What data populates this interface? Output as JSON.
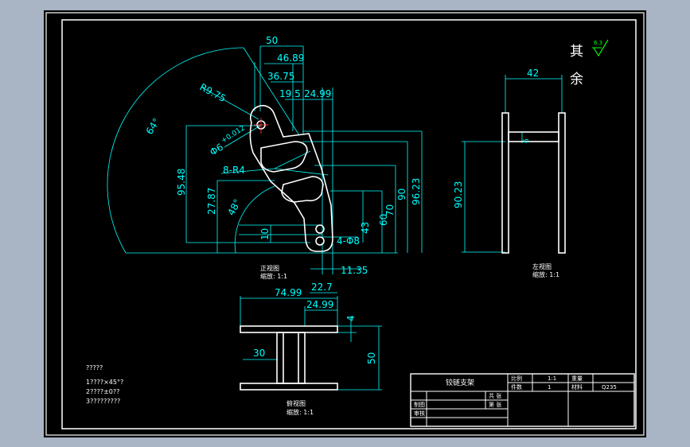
{
  "colors": {
    "backdrop": "#a9b4c4",
    "sheet": "#000000",
    "part": "#ffffff",
    "dimension": "#00ffff",
    "center": "#ff3b3b",
    "roughness": "#00ff00"
  },
  "front_view": {
    "dims": {
      "d50": "50",
      "d46_89": "46.89",
      "d36_75": "36.75",
      "d19_5": "19.5",
      "d24_99": "24.99",
      "r9_75": "R9.75",
      "a64": "64°",
      "phi6": "Φ6",
      "tol": "+0.012",
      "r4": "8-R4",
      "d95_48": "95.48",
      "d27_87": "27.87",
      "a48": "48°",
      "d10": "10",
      "d43": "43",
      "d60": "60",
      "d70": "70",
      "d90": "90",
      "d96_23": "96.23",
      "hole": "4-Φ8",
      "d11_35": "11.35"
    },
    "caption": "正视图",
    "scale": "缩放: 1:1"
  },
  "left_view": {
    "dims": {
      "d42": "42",
      "d6": "6",
      "d90_23": "90.23"
    },
    "caption": "左视图",
    "scale": "缩放: 1:1"
  },
  "top_view": {
    "dims": {
      "d74_99": "74.99",
      "d22_7": "22.7",
      "d24_99": "24.99",
      "d4": "4",
      "d30": "30",
      "d50": "50"
    },
    "caption": "俯视图",
    "scale": "缩放: 1:1"
  },
  "roughness_note": {
    "chars": [
      "其",
      "余"
    ],
    "value": "6.3"
  },
  "tech_notes": [
    "?????",
    "1????×45°?",
    "2????±0??",
    "3?????????"
  ],
  "title_block": {
    "part_name": "铰链支架",
    "labels": [
      "比例",
      "件数",
      "重量",
      "材料",
      "共 张",
      "第 张",
      "制图",
      "审核"
    ],
    "values": [
      "1:1",
      "1",
      "Q235"
    ]
  }
}
